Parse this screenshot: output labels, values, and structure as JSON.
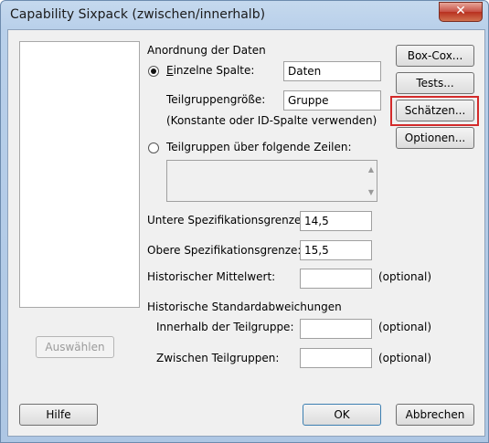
{
  "window": {
    "title": "Capability Sixpack (zwischen/innerhalb)",
    "close_glyph": "✕"
  },
  "left": {
    "select_label": "Auswählen"
  },
  "arrangement": {
    "heading": "Anordnung der Daten",
    "single_column_label": "Einzelne Spalte:",
    "single_column_value": "Daten",
    "subgroup_size_label": "Teilgruppengröße:",
    "subgroup_size_value": "Gruppe",
    "subgroup_hint": "(Konstante oder ID-Spalte verwenden)",
    "subgroups_rows_label": "Teilgruppen über folgende Zeilen:"
  },
  "specs": {
    "lower_label": "Untere Spezifikationsgrenze:",
    "lower_value": "14,5",
    "upper_label": "Obere Spezifikationsgrenze:",
    "upper_value": "15,5",
    "hist_mean_label": "Historischer Mittelwert:",
    "hist_mean_value": "",
    "optional": "(optional)"
  },
  "hist_std": {
    "heading": "Historische Standardabweichungen",
    "within_label": "Innerhalb der Teilgruppe:",
    "within_value": "",
    "between_label": "Zwischen Teilgruppen:",
    "between_value": ""
  },
  "side_buttons": {
    "boxcox": "Box-Cox...",
    "tests": "Tests...",
    "estimate": "Schätzen...",
    "options": "Optionen..."
  },
  "footer": {
    "help": "Hilfe",
    "ok": "OK",
    "cancel": "Abbrechen"
  },
  "colors": {
    "highlight": "#d32a2a",
    "title_bar": "#b9d0ea"
  }
}
